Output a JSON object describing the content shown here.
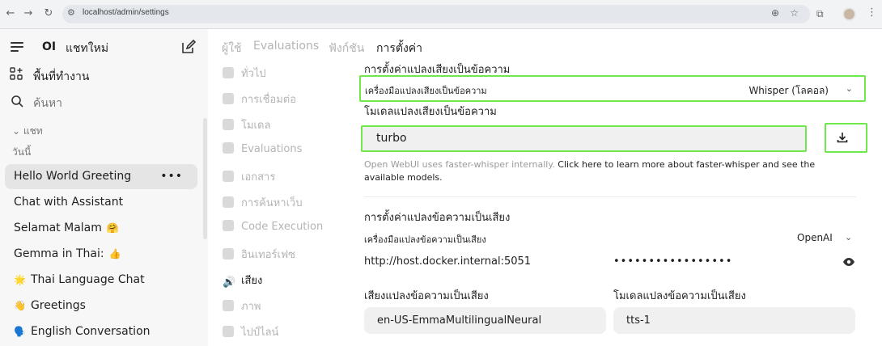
{
  "browser": {
    "url": "localhost/admin/settings"
  },
  "sidebar": {
    "brand": "OI",
    "new_chat": "แชทใหม่",
    "workspace": "พื้นที่ทำงาน",
    "search": "ค้นหา",
    "folder": "แชท",
    "group_today": "วันนี้",
    "chats": [
      {
        "title": "Hello World Greeting",
        "emoji_before": "",
        "emoji_after": ""
      },
      {
        "title": "Chat with Assistant",
        "emoji_before": "",
        "emoji_after": ""
      },
      {
        "title": "Selamat Malam",
        "emoji_before": "",
        "emoji_after": "🤗"
      },
      {
        "title": "Gemma in Thai:",
        "emoji_before": "",
        "emoji_after": "👍"
      },
      {
        "title": "Thai Language Chat",
        "emoji_before": "🌟",
        "emoji_after": ""
      },
      {
        "title": "Greetings",
        "emoji_before": "👋",
        "emoji_after": ""
      },
      {
        "title": "English Conversation",
        "emoji_before": "🗣️",
        "emoji_after": ""
      }
    ],
    "more": "•••"
  },
  "tabs": [
    "ผู้ใช้",
    "Evaluations",
    "ฟังก์ชัน",
    "การตั้งค่า"
  ],
  "settings_menu": [
    "ทั่วไป",
    "การเชื่อมต่อ",
    "โมเดล",
    "Evaluations",
    "เอกสาร",
    "การค้นหาเว็บ",
    "Code Execution",
    "อินเทอร์เฟซ",
    "เสียง",
    "ภาพ",
    "ไปป์ไลน์"
  ],
  "stt": {
    "heading": "การตั้งค่าแปลงเสียงเป็นข้อความ",
    "engine_label": "เครื่องมือแปลงเสียงเป็นข้อความ",
    "engine_value": "Whisper (โลคอล)",
    "model_heading": "โมเดลแปลงเสียงเป็นข้อความ",
    "model_value": "turbo",
    "help_text": "Open WebUI uses faster-whisper internally.",
    "help_link": "Click here to learn more about faster-whisper and see the available models."
  },
  "tts": {
    "heading": "การตั้งค่าแปลงข้อความเป็นเสียง",
    "engine_label": "เครื่องมือแปลงข้อความเป็นเสียง",
    "engine_value": "OpenAI",
    "api_url": "http://host.docker.internal:5051",
    "api_key_masked": "•••••••••••••••••",
    "voice_label": "เสียงแปลงข้อความเป็นเสียง",
    "voice_value": "en-US-EmmaMultilingualNeural",
    "model_label": "โมเดลแปลงข้อความเป็นเสียง",
    "model_value": "tts-1"
  }
}
